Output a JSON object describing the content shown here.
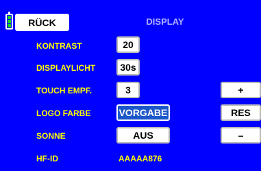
{
  "header": {
    "back_label": "RÜCK",
    "title": "DISPLAY",
    "battery_cells": 4
  },
  "rows": [
    {
      "label": "KONTRAST",
      "value": "20"
    },
    {
      "label": "DISPLAYLICHT",
      "value": "30s"
    },
    {
      "label": "TOUCH EMPF.",
      "value": "3"
    },
    {
      "label": "LOGO FARBE",
      "value": "VORGABE"
    },
    {
      "label": "SONNE",
      "value": "AUS"
    },
    {
      "label": "HF-ID",
      "value": "AAAAA876"
    }
  ],
  "side_buttons": {
    "plus": "+",
    "reset": "RES",
    "minus": "–"
  },
  "colors": {
    "background": "#0000ff",
    "label_text": "#ffff00",
    "highlight": "#1b57c9",
    "battery": "#17d81b"
  }
}
